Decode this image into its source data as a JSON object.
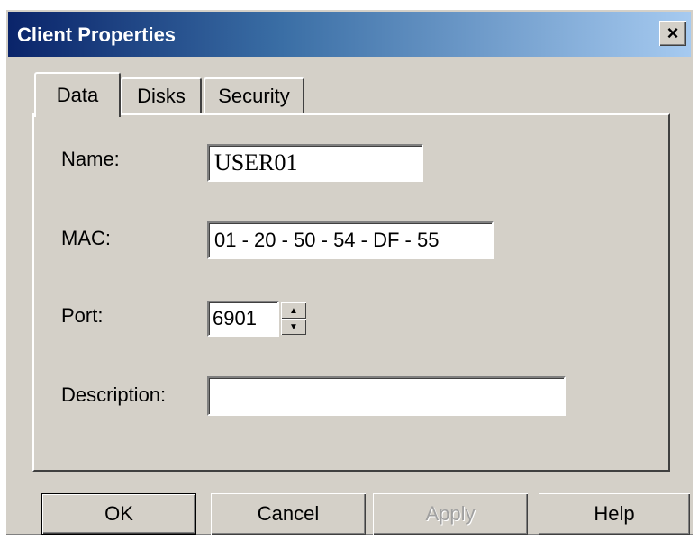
{
  "window": {
    "title": "Client Properties",
    "close_label": "×"
  },
  "tabs": [
    {
      "label": "Data",
      "active": true
    },
    {
      "label": "Disks",
      "active": false
    },
    {
      "label": "Security",
      "active": false
    }
  ],
  "form": {
    "name": {
      "label": "Name:",
      "value": "USER01"
    },
    "mac": {
      "label": "MAC:",
      "value": "01 - 20 - 50 - 54 - DF - 55"
    },
    "port": {
      "label": "Port:",
      "value": "6901",
      "up_icon": "▲",
      "down_icon": "▼"
    },
    "description": {
      "label": "Description:",
      "value": ""
    }
  },
  "buttons": {
    "ok": "OK",
    "cancel": "Cancel",
    "apply": "Apply",
    "help": "Help"
  },
  "colors": {
    "titlebar_start": "#0a246a",
    "titlebar_end": "#a6caf0",
    "face": "#d4d0c8"
  }
}
